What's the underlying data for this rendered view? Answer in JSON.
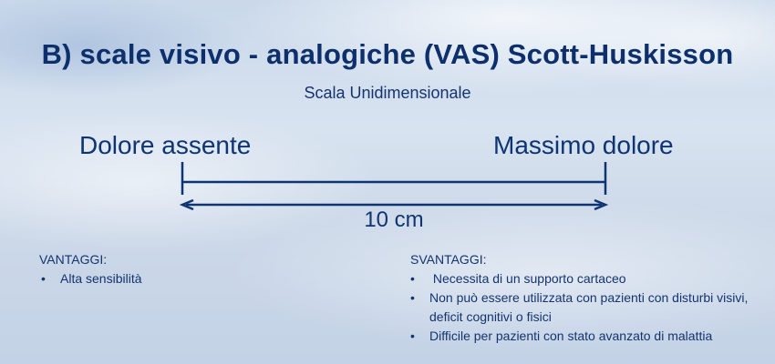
{
  "slide": {
    "title": "B) scale visivo - analogiche (VAS) Scott-Huskisson",
    "subtitle": "Scala Unidimensionale"
  },
  "scale": {
    "left_label": "Dolore assente",
    "right_label": "Massimo dolore",
    "length_label": "10 cm",
    "line_color": "#0f3472"
  },
  "advantages": {
    "heading": "VANTAGGI:",
    "items": [
      "Alta sensibilità"
    ]
  },
  "disadvantages": {
    "heading": "SVANTAGGI:",
    "items": [
      " Necessita di un supporto cartaceo",
      "Non può essere utilizzata con pazienti con disturbi visivi, deficit cognitivi o fisici",
      "Difficile per pazienti con stato avanzato di malattia"
    ]
  },
  "colors": {
    "text": "#0d2f6b"
  }
}
